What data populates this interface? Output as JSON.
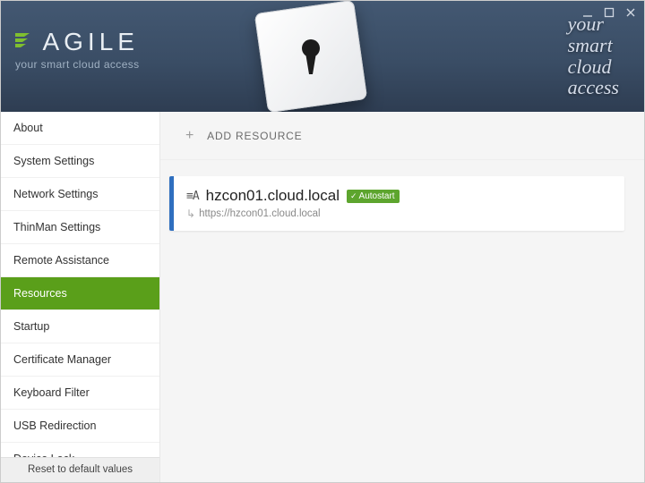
{
  "window_controls": {
    "minimize": "minimize",
    "maximize": "maximize",
    "close": "close"
  },
  "header": {
    "brand_name": "AGILE",
    "brand_subtitle": "your smart cloud access",
    "tagline_l1": "your",
    "tagline_l2": "smart",
    "tagline_l3": "cloud",
    "tagline_l4": "access"
  },
  "sidebar": {
    "items": [
      {
        "label": "About",
        "active": false
      },
      {
        "label": "System Settings",
        "active": false
      },
      {
        "label": "Network Settings",
        "active": false
      },
      {
        "label": "ThinMan Settings",
        "active": false
      },
      {
        "label": "Remote Assistance",
        "active": false
      },
      {
        "label": "Resources",
        "active": true
      },
      {
        "label": "Startup",
        "active": false
      },
      {
        "label": "Certificate Manager",
        "active": false
      },
      {
        "label": "Keyboard Filter",
        "active": false
      },
      {
        "label": "USB Redirection",
        "active": false
      },
      {
        "label": "Device Lock",
        "active": false
      }
    ],
    "footer_label": "Reset to default values"
  },
  "content": {
    "add_resource_label": "ADD RESOURCE",
    "resources": [
      {
        "title": "hzcon01.cloud.local",
        "badge": "Autostart",
        "url": "https://hzcon01.cloud.local"
      }
    ]
  },
  "colors": {
    "accent_green": "#5a9f1a",
    "badge_green": "#5da52e",
    "resource_blue": "#2f6fbf"
  }
}
